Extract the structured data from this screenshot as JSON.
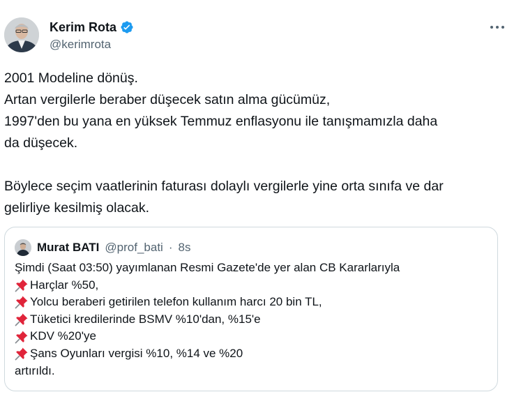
{
  "author": {
    "display_name": "Kerim Rota",
    "handle": "@kerimrota"
  },
  "tweet": {
    "paragraph1": [
      "2001 Modeline dönüş.",
      "Artan vergilerle beraber düşecek satın alma gücümüz,",
      "1997'den bu yana en yüksek Temmuz enflasyonu ile tanışmamızla daha",
      "da düşecek."
    ],
    "paragraph2": [
      "Böylece seçim vaatlerinin faturası dolaylı vergilerle yine orta sınıfa ve dar",
      "gelirliye kesilmiş olacak."
    ]
  },
  "quoted_tweet": {
    "display_name": "Murat BATI",
    "handle": "@prof_bati",
    "separator": "·",
    "time": "8s",
    "intro": "Şimdi (Saat 03:50) yayımlanan Resmi Gazete'de yer alan CB Kararlarıyla",
    "items": [
      "Harçlar %50,",
      "Yolcu beraberi getirilen telefon kullanım harcı 20 bin TL,",
      "Tüketici kredilerinde BSMV %10'dan, %15'e",
      "KDV %20'ye",
      "Şans Oyunları vergisi %10, %14 ve %20"
    ],
    "outro": "artırıldı."
  },
  "icons": {
    "verified": "verified-badge-icon",
    "more": "more-options-icon",
    "pin": "pushpin-emoji-icon"
  },
  "colors": {
    "verified_blue": "#1d9bf0",
    "secondary_text": "#536471",
    "border": "#cfd9de",
    "pin_red": "#e0243a"
  }
}
